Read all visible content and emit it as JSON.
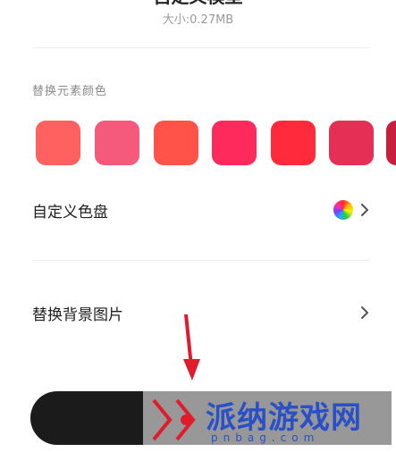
{
  "header": {
    "title_cut": "自定义模型",
    "size_text": "大小:0.27MB"
  },
  "palette": {
    "section_label": "替换元素颜色",
    "swatches": [
      {
        "color": "#ff6060"
      },
      {
        "color": "#f55a7c"
      },
      {
        "color": "#ff5249"
      },
      {
        "color": "#ff2a5c"
      },
      {
        "color": "#ff2b3d"
      },
      {
        "color": "#e52f55"
      },
      {
        "color": "#c8203c"
      }
    ]
  },
  "rows": {
    "custom_palette_label": "自定义色盘",
    "replace_bg_label": "替换背景图片"
  },
  "watermark": {
    "brand": "派纳游戏网",
    "domain": "pnbag.com"
  },
  "colors": {
    "accent_arrow": "#e11b2b",
    "button_bg": "#1b1b1b"
  }
}
